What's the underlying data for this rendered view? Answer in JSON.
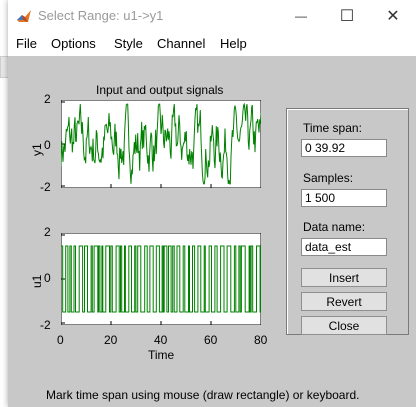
{
  "window": {
    "title": "Select Range: u1->y1",
    "minimize_glyph": "—",
    "maximize_glyph": "☐",
    "close_glyph": "✕"
  },
  "menu": [
    "File",
    "Options",
    "Style",
    "Channel",
    "Help"
  ],
  "plot": {
    "title": "Input and output signals",
    "top": {
      "ylabel": "y1",
      "yticks": [
        "2",
        "0",
        "-2"
      ],
      "ylim": [
        -2,
        2
      ]
    },
    "bottom": {
      "ylabel": "u1",
      "yticks": [
        "2",
        "0",
        "-2"
      ],
      "ylim": [
        -2,
        2
      ]
    },
    "xticks": [
      "0",
      "20",
      "40",
      "60",
      "80"
    ],
    "xlim": [
      0,
      80
    ],
    "xlabel": "Time",
    "line_color": "#008000"
  },
  "controls": {
    "time_span_label": "Time span:",
    "time_span_value": "0 39.92",
    "samples_label": "Samples:",
    "samples_value": "1 500",
    "data_name_label": "Data name:",
    "data_name_value": "data_est",
    "insert_label": "Insert",
    "revert_label": "Revert",
    "close_label": "Close"
  },
  "status_text": "Mark time span using mouse (draw rectangle) or keyboard."
}
